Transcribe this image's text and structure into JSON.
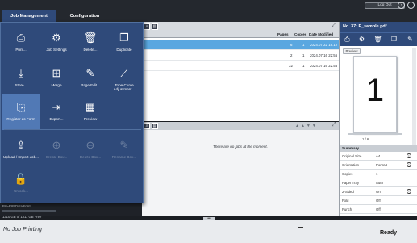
{
  "tabs": {
    "job_management": "Job Management",
    "configuration": "Configuration"
  },
  "header": {
    "logout": "Log Out",
    "icons": [
      "help-icon",
      "info-icon"
    ]
  },
  "job_list": {
    "columns": [
      "Pages",
      "Copies",
      "Date Modified"
    ],
    "rows": [
      {
        "pages": "6",
        "copies": "1",
        "date": "2024.07.22 19:12",
        "selected": true
      },
      {
        "pages": "2",
        "copies": "1",
        "date": "2024.07.16 22:56",
        "selected": false
      },
      {
        "pages": "32",
        "copies": "1",
        "date": "2024.07.16 22:56",
        "selected": false
      }
    ]
  },
  "history": {
    "empty_text": "There are no jobs at the moment."
  },
  "storage": {
    "label": "Pre-RIP Data/Form",
    "usage": "1310 GB of 1311 GB Free"
  },
  "menu": {
    "items": [
      {
        "label": "Print...",
        "icon": "print-icon",
        "enabled": true
      },
      {
        "label": "Job Settings",
        "icon": "job-settings-icon",
        "enabled": true
      },
      {
        "label": "Delete...",
        "icon": "trash-icon",
        "enabled": true
      },
      {
        "label": "Duplicate",
        "icon": "duplicate-icon",
        "enabled": true
      },
      {
        "label": "Store...",
        "icon": "store-icon",
        "enabled": true
      },
      {
        "label": "Merge",
        "icon": "merge-icon",
        "enabled": true
      },
      {
        "label": "Page Edit...",
        "icon": "page-edit-icon",
        "enabled": true
      },
      {
        "label": "Tone Curve Adjustment...",
        "icon": "tone-curve-icon",
        "enabled": true
      },
      {
        "label": "Register as Form",
        "icon": "register-form-icon",
        "enabled": true,
        "highlighted": true
      },
      {
        "label": "Export...",
        "icon": "export-icon",
        "enabled": true
      },
      {
        "label": "Preview",
        "icon": "preview-icon",
        "enabled": true
      },
      {
        "label": "Upload / Import Job...",
        "icon": "upload-icon",
        "enabled": true
      },
      {
        "label": "Create Box...",
        "icon": "create-box-icon",
        "enabled": false
      },
      {
        "label": "Delete Box...",
        "icon": "delete-box-icon",
        "enabled": false
      },
      {
        "label": "Rename Box...",
        "icon": "rename-box-icon",
        "enabled": false
      },
      {
        "label": "Unlock...",
        "icon": "unlock-icon",
        "enabled": false
      }
    ]
  },
  "preview": {
    "title": "No. 37: E_sample.pdf",
    "preview_button": "Preview",
    "page_number": "1",
    "page_counter": "1 / 6",
    "summary_title": "Summary",
    "summary": [
      {
        "key": "Original Size",
        "value": "A4"
      },
      {
        "key": "Orientation",
        "value": "Portrait"
      },
      {
        "key": "Copies",
        "value": "1"
      },
      {
        "key": "Paper Tray",
        "value": "Auto"
      },
      {
        "key": "2-Sided",
        "value": "On"
      },
      {
        "key": "Fold",
        "value": "Off"
      },
      {
        "key": "Punch",
        "value": "Off"
      }
    ]
  },
  "status": {
    "left": "No Job Printing",
    "right": "Ready"
  },
  "colors": {
    "menu_bg": "#2f4a7a",
    "highlight": "#5179b5",
    "selected_row": "#5aa7e0"
  }
}
